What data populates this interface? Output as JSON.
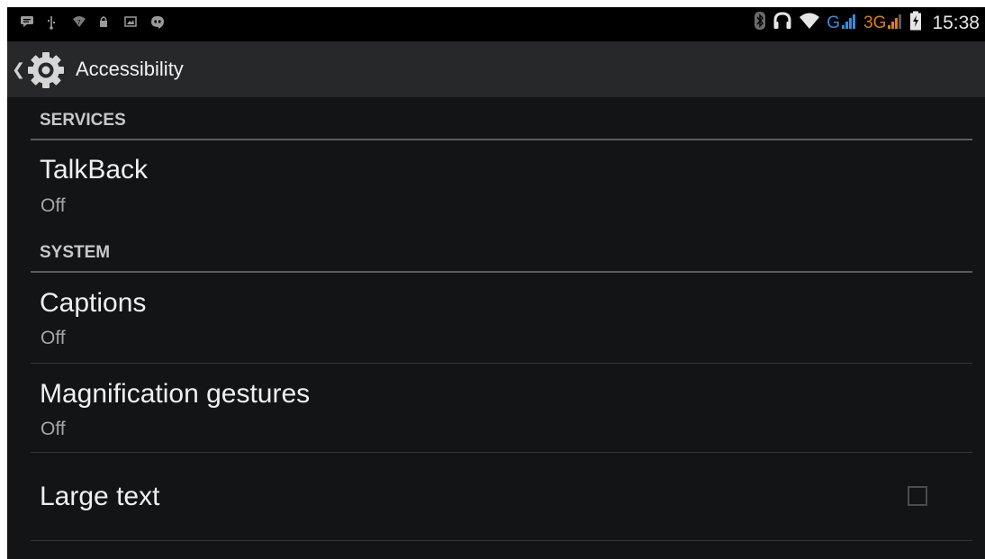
{
  "status_bar": {
    "left_icons": [
      "message-icon",
      "usb-icon",
      "wifi-question-icon",
      "lock-icon",
      "image-icon",
      "hangouts-icon"
    ],
    "network_g": "G",
    "network_3g": "3G",
    "time": "15:38"
  },
  "action_bar": {
    "title": "Accessibility"
  },
  "sections": [
    {
      "header": "SERVICES",
      "items": [
        {
          "title": "TalkBack",
          "summary": "Off"
        }
      ]
    },
    {
      "header": "SYSTEM",
      "items": [
        {
          "title": "Captions",
          "summary": "Off"
        },
        {
          "title": "Magnification gestures",
          "summary": "Off"
        },
        {
          "title": "Large text",
          "checked": false
        }
      ]
    }
  ],
  "colors": {
    "background": "#121416",
    "action_bar": "#262829",
    "accent_blue": "#2f8fdc",
    "accent_orange": "#e07b12"
  }
}
